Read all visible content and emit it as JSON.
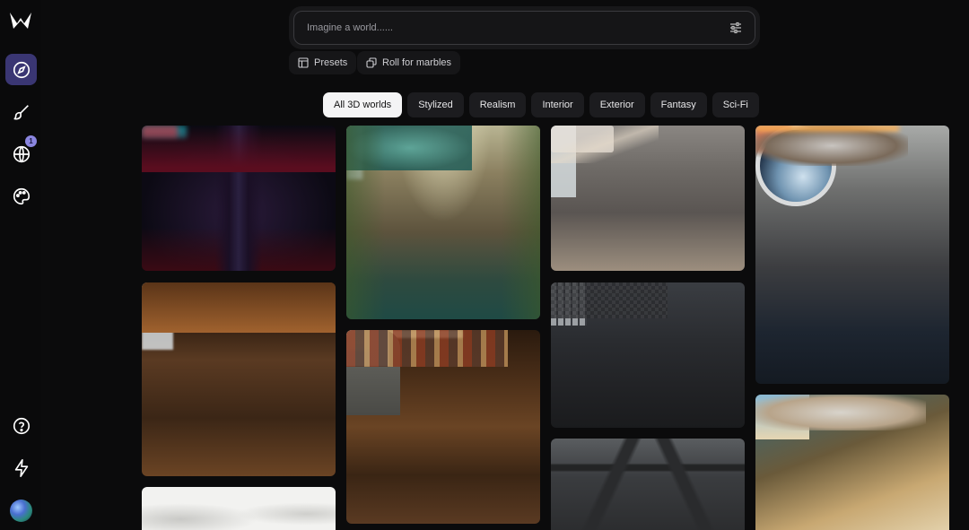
{
  "search": {
    "placeholder": "Imagine a world......"
  },
  "actions": {
    "presets": "Presets",
    "roll": "Roll for marbles"
  },
  "tabs": [
    {
      "label": "All 3D worlds",
      "active": true
    },
    {
      "label": "Stylized"
    },
    {
      "label": "Realism"
    },
    {
      "label": "Interior"
    },
    {
      "label": "Exterior"
    },
    {
      "label": "Fantasy"
    },
    {
      "label": "Sci-Fi"
    }
  ],
  "sidebar": {
    "items": [
      {
        "icon": "compass-icon",
        "active": true
      },
      {
        "icon": "brush-icon"
      },
      {
        "icon": "globe-icon",
        "badge": "1"
      },
      {
        "icon": "palette-icon"
      }
    ],
    "bottom": [
      {
        "icon": "help-icon"
      },
      {
        "icon": "lightning-icon"
      }
    ]
  },
  "gallery": [
    {
      "name": "world-card-neon-alley"
    },
    {
      "name": "world-card-ruined-waterfall"
    },
    {
      "name": "world-card-cave-bedroom"
    },
    {
      "name": "world-card-spaceship-bedroom"
    },
    {
      "name": "world-card-wooden-kitchen"
    },
    {
      "name": "world-card-log-cabin"
    },
    {
      "name": "world-card-dark-parlor"
    },
    {
      "name": "world-card-whimsical-bedroom"
    },
    {
      "name": "world-card-sketch"
    },
    {
      "name": "world-card-beamed-ceiling"
    }
  ],
  "colors": {
    "accent": "#3a3673",
    "badge": "#8b86e0",
    "background": "#0b0b0c"
  }
}
